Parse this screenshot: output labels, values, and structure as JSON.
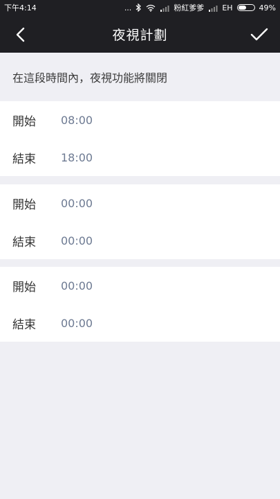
{
  "status_bar": {
    "time": "下午4:14",
    "dots": "...",
    "carrier": "粉紅爹爹",
    "network": "EH",
    "battery_text": "49%",
    "battery_level": 0.49
  },
  "nav": {
    "title": "夜視計劃"
  },
  "description": "在這段時間內，夜視功能將關閉",
  "schedules": [
    {
      "start_label": "開始",
      "start_value": "08:00",
      "end_label": "結束",
      "end_value": "18:00"
    },
    {
      "start_label": "開始",
      "start_value": "00:00",
      "end_label": "結束",
      "end_value": "00:00"
    },
    {
      "start_label": "開始",
      "start_value": "00:00",
      "end_label": "結束",
      "end_value": "00:00"
    }
  ],
  "icons": {
    "back": "chevron-left-icon",
    "confirm": "checkmark-icon",
    "bluetooth": "bluetooth-icon",
    "wifi": "wifi-icon",
    "signal": "signal-icon",
    "battery": "battery-icon"
  }
}
